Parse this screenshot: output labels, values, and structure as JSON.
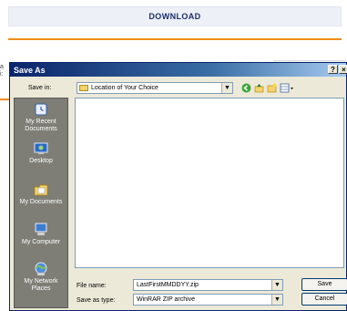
{
  "page": {
    "header_title": "DOWNLOAD"
  },
  "dialog": {
    "title": "Save As",
    "title_buttons": {
      "help": "?",
      "close": "×"
    },
    "save_in": {
      "label": "Save in:",
      "value": "Location of Your Choice"
    },
    "places": [
      {
        "label": "My Recent Documents",
        "icon": "recent-documents-icon"
      },
      {
        "label": "Desktop",
        "icon": "desktop-icon"
      },
      {
        "label": "My Documents",
        "icon": "my-documents-icon"
      },
      {
        "label": "My Computer",
        "icon": "my-computer-icon"
      },
      {
        "label": "My Network Places",
        "icon": "network-places-icon"
      }
    ],
    "file_name": {
      "label": "File name:",
      "value": "LastFirstMMDDYY.zip"
    },
    "save_as_type": {
      "label": "Save as type:",
      "value": "WinRAR ZIP archive"
    },
    "buttons": {
      "save": "Save",
      "cancel": "Cancel"
    }
  }
}
